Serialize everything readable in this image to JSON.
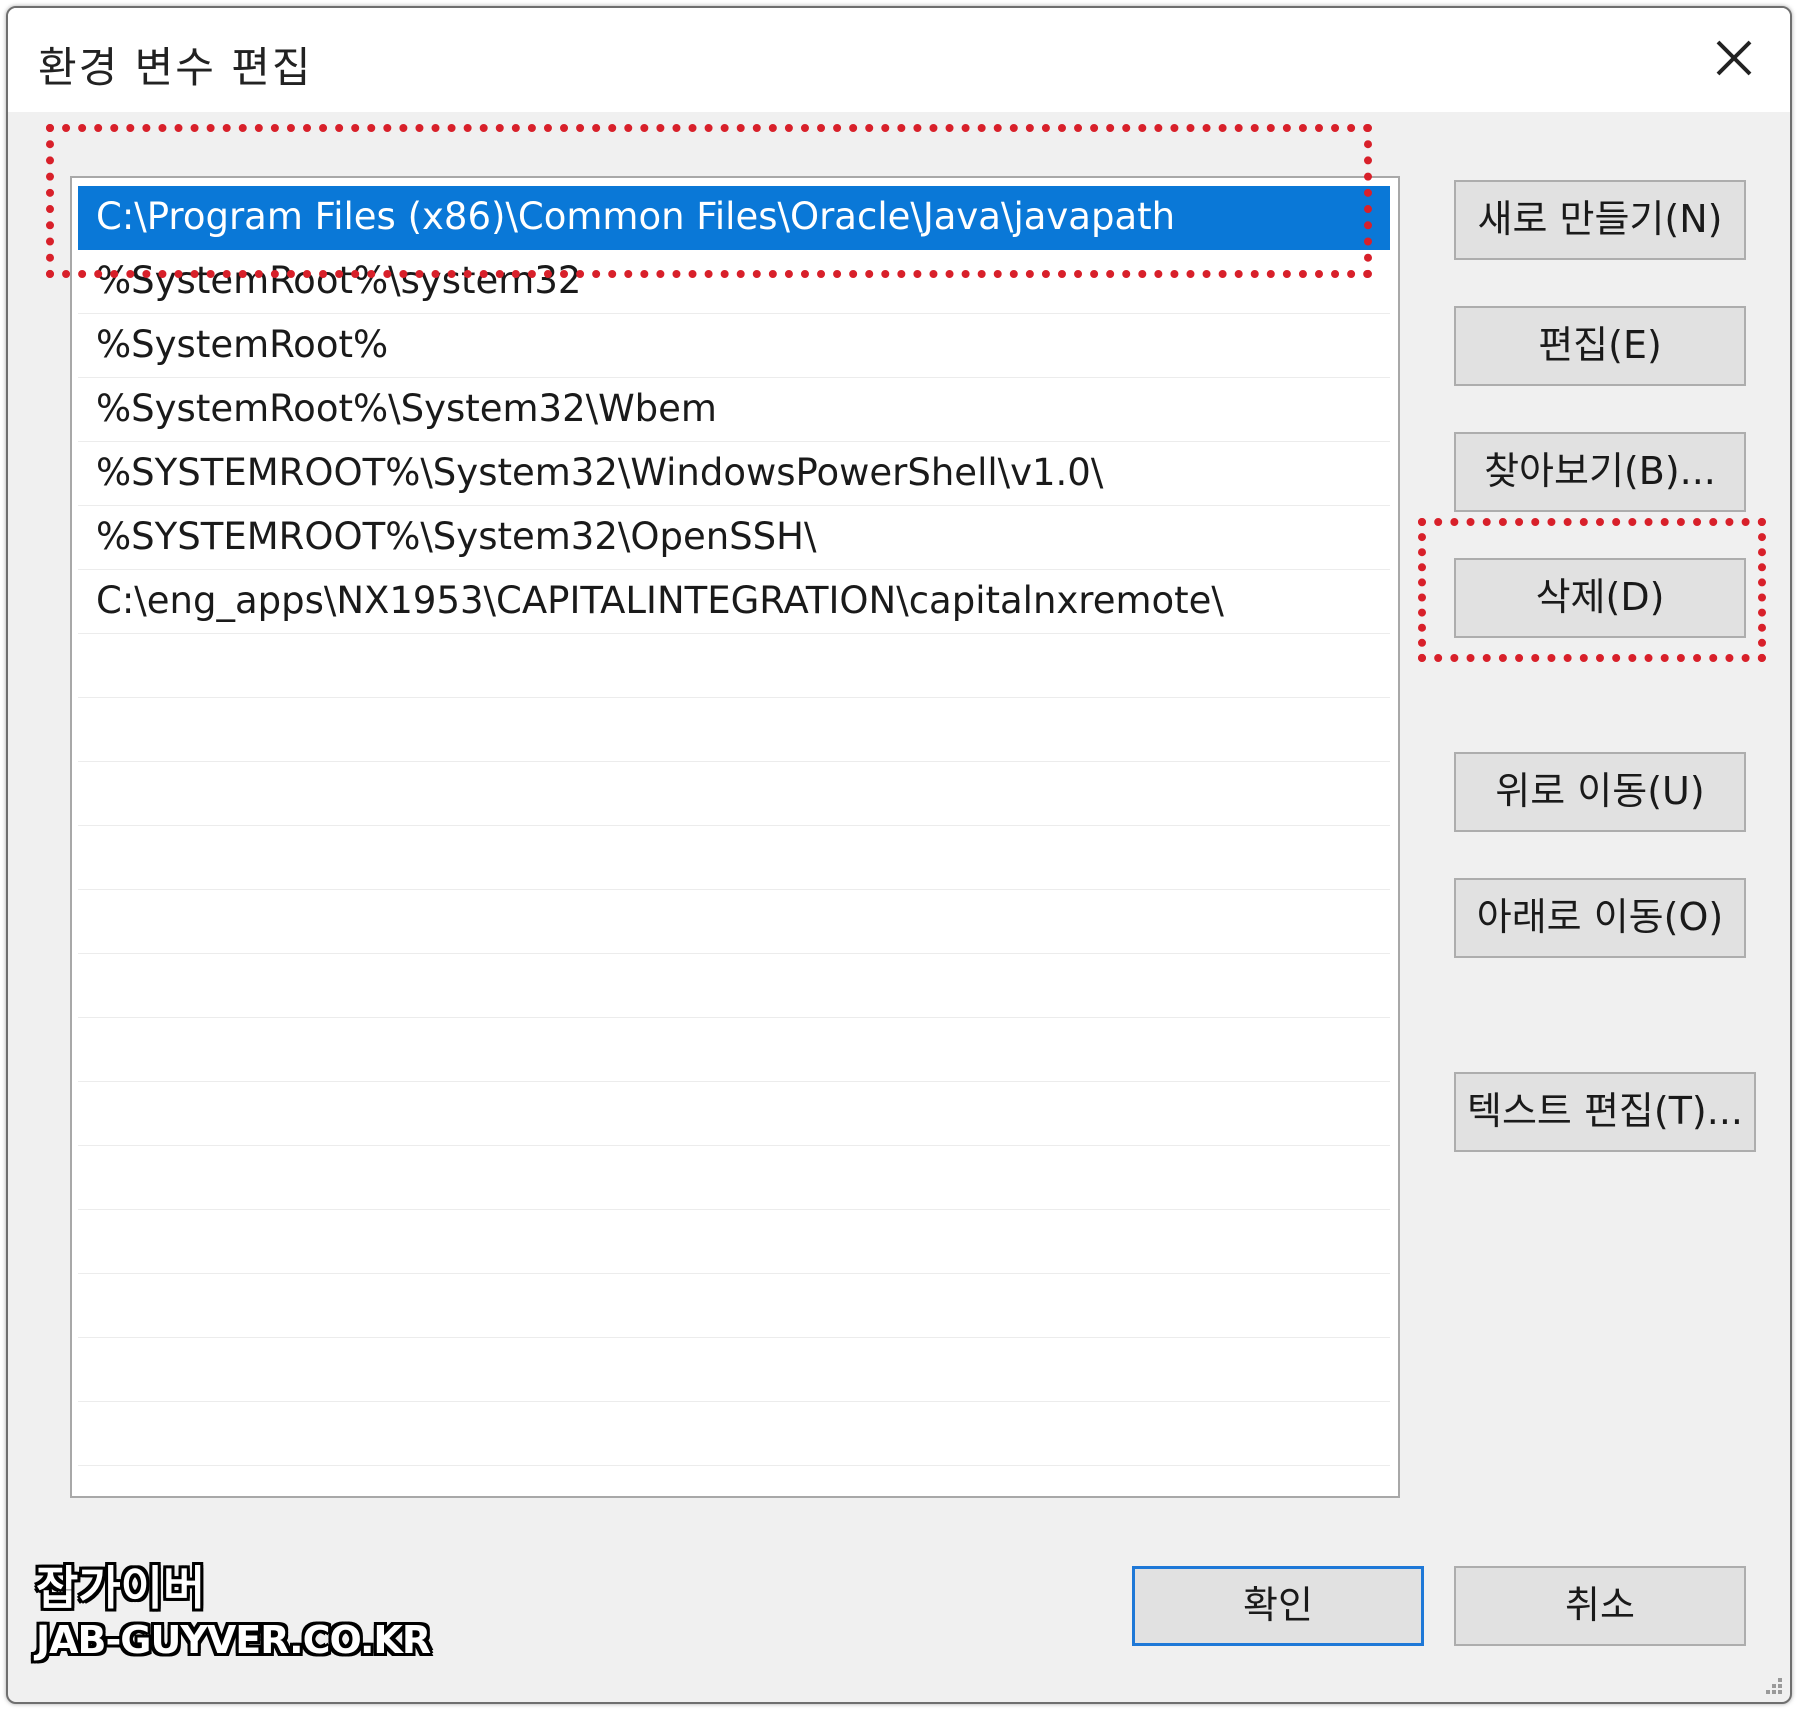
{
  "window": {
    "title": "환경 변수 편집"
  },
  "path_list": {
    "items": [
      {
        "label": "C:\\Program Files (x86)\\Common Files\\Oracle\\Java\\javapath",
        "selected": true
      },
      {
        "label": "%SystemRoot%\\system32",
        "selected": false
      },
      {
        "label": "%SystemRoot%",
        "selected": false
      },
      {
        "label": "%SystemRoot%\\System32\\Wbem",
        "selected": false
      },
      {
        "label": "%SYSTEMROOT%\\System32\\WindowsPowerShell\\v1.0\\",
        "selected": false
      },
      {
        "label": "%SYSTEMROOT%\\System32\\OpenSSH\\",
        "selected": false
      },
      {
        "label": "C:\\eng_apps\\NX1953\\CAPITALINTEGRATION\\capitalnxremote\\",
        "selected": false
      }
    ]
  },
  "buttons": {
    "new": "새로 만들기(N)",
    "edit": "편집(E)",
    "browse": "찾아보기(B)...",
    "delete": "삭제(D)",
    "move_up": "위로 이동(U)",
    "move_down": "아래로 이동(O)",
    "edit_text": "텍스트 편집(T)...",
    "ok": "확인",
    "cancel": "취소"
  },
  "watermark": {
    "line1": "잡가이버",
    "line2": "JAB-GUYVER.CO.KR"
  },
  "colors": {
    "selection": "#0a78d7",
    "highlight": "#d8202a",
    "ok_border": "#1e78d7"
  }
}
